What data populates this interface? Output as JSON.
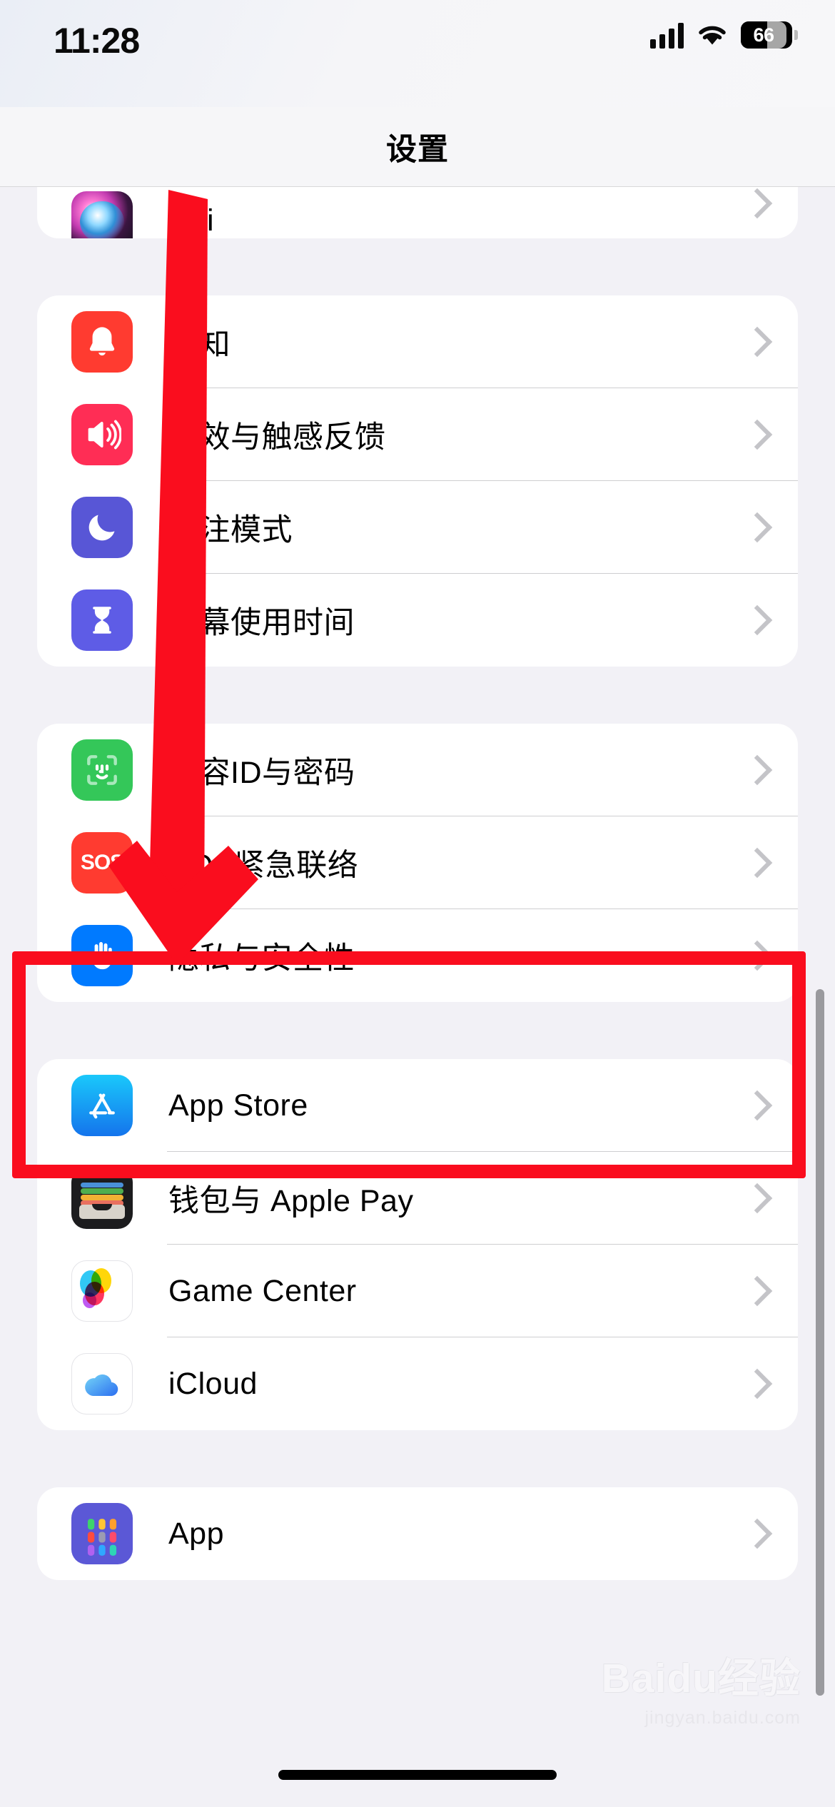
{
  "status_bar": {
    "time": "11:28",
    "cellular_icon": "cellular-signal-icon",
    "wifi_icon": "wifi-icon",
    "battery_level": "66",
    "battery_icon": "battery-icon"
  },
  "nav": {
    "title": "设置"
  },
  "groups": [
    {
      "id": "group-siri",
      "partial_top": true,
      "rows": [
        {
          "label": "Siri",
          "icon": "siri-icon",
          "icon_class": "ic-siri",
          "partial": true
        }
      ]
    },
    {
      "id": "group-notifications",
      "rows": [
        {
          "label": "通知",
          "icon": "notifications-bell-icon",
          "icon_class": "ic-notif"
        },
        {
          "label": "声效与触感反馈",
          "icon": "sound-haptics-speaker-icon",
          "icon_class": "ic-sound"
        },
        {
          "label": "专注模式",
          "icon": "focus-moon-icon",
          "icon_class": "ic-focus"
        },
        {
          "label": "屏幕使用时间",
          "icon": "screen-time-hourglass-icon",
          "icon_class": "ic-screen"
        }
      ]
    },
    {
      "id": "group-security",
      "rows": [
        {
          "label": "面容ID与密码",
          "icon": "face-id-icon",
          "icon_class": "ic-faceid"
        },
        {
          "label": "SOS紧急联络",
          "icon": "emergency-sos-icon",
          "icon_class": "ic-sos"
        },
        {
          "label": "隐私与安全性",
          "icon": "privacy-hand-icon",
          "icon_class": "ic-privacy",
          "highlighted": true
        }
      ]
    },
    {
      "id": "group-services",
      "rows": [
        {
          "label": "App Store",
          "icon": "app-store-icon",
          "icon_class": "ic-appstore"
        },
        {
          "label": "钱包与 Apple Pay",
          "icon": "wallet-apple-pay-icon",
          "icon_class": "ic-wallet"
        },
        {
          "label": "Game Center",
          "icon": "game-center-icon",
          "icon_class": "ic-white"
        },
        {
          "label": "iCloud",
          "icon": "icloud-icon",
          "icon_class": "ic-white"
        }
      ]
    },
    {
      "id": "group-apps",
      "rows": [
        {
          "label": "App",
          "icon": "app-grid-icon",
          "icon_class": "ic-app"
        }
      ]
    }
  ],
  "annotation": {
    "highlight_color": "#fa0d1e",
    "arrow_color": "#fa0d1e",
    "target_label": "隐私与安全性"
  },
  "watermark": {
    "main": "Baidu经验",
    "sub": "jingyan.baidu.com"
  },
  "chevron_icon": "chevron-right-icon",
  "scrollbar": "vertical-scrollbar",
  "home_indicator": "home-indicator"
}
